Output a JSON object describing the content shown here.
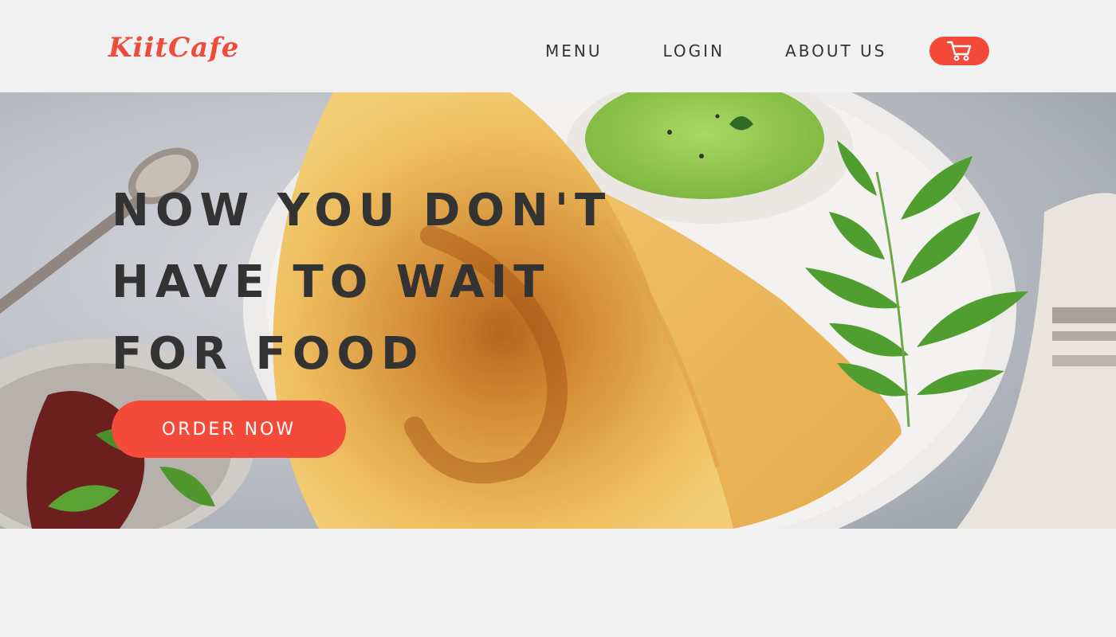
{
  "brand": {
    "logo_text": "KiitCafe",
    "logo_color": "#f04a3a",
    "accent_color": "#f44a39",
    "text_color": "#333333"
  },
  "nav": {
    "items": [
      {
        "label": "MENU"
      },
      {
        "label": "LOGIN"
      },
      {
        "label": "ABOUT US"
      }
    ],
    "cart_icon": "cart-icon"
  },
  "hero": {
    "headline_lines": [
      "NOW YOU DON'T",
      "HAVE TO WAIT",
      "FOR FOOD"
    ],
    "cta_label": "ORDER NOW",
    "image_subject": "dosa-with-chutney-plate"
  }
}
